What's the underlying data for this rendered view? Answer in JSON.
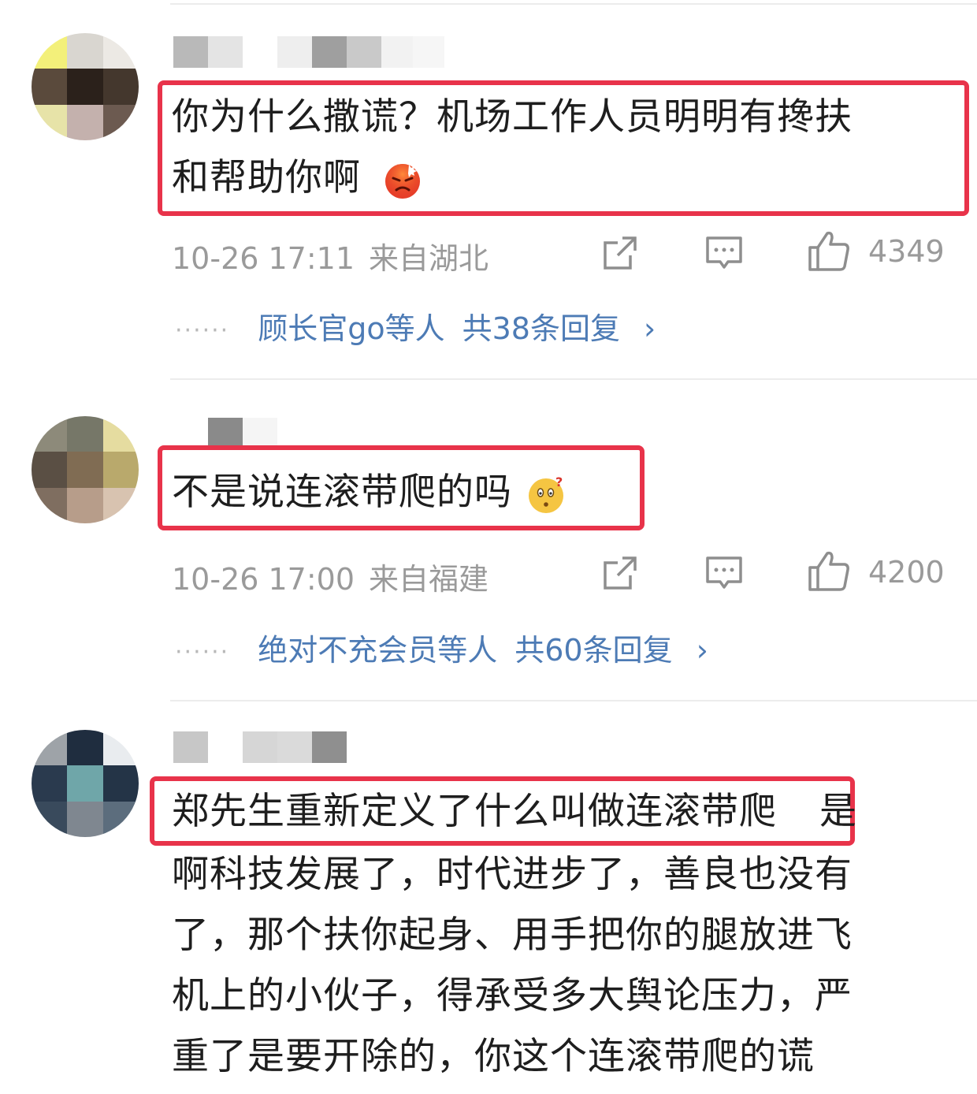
{
  "comments": [
    {
      "text_line1": "你为什么撒谎？机场工作人员明明有搀扶",
      "text_line2": "和帮助你啊",
      "emoji": "angry-face-icon",
      "time": "10-26 17:11",
      "location": "来自湖北",
      "likes": "4349",
      "reply_users": "顾长官go等人",
      "reply_total": "共38条回复",
      "reply_arrow": "›"
    },
    {
      "text_line1": "不是说连滚带爬的吗",
      "emoji": "confused-face-icon",
      "time": "10-26 17:00",
      "location": "来自福建",
      "likes": "4200",
      "reply_users": "绝对不充会员等人",
      "reply_total": "共60条回复",
      "reply_arrow": "›"
    },
    {
      "text_highlight": "郑先生重新定义了什么叫做连滚带爬",
      "text_after": "是",
      "text_lines": [
        "啊科技发展了，时代进步了，善良也没有",
        "了，那个扶你起身、用手把你的腿放进飞",
        "机上的小伙子，得承受多大舆论压力，严",
        "重了是要开除的，你这个连滚带爬的谎"
      ]
    }
  ],
  "reply_dots": "······",
  "colors": {
    "highlight": "#e8334a",
    "link": "#4d7bb5",
    "meta": "#9a9a9a"
  }
}
